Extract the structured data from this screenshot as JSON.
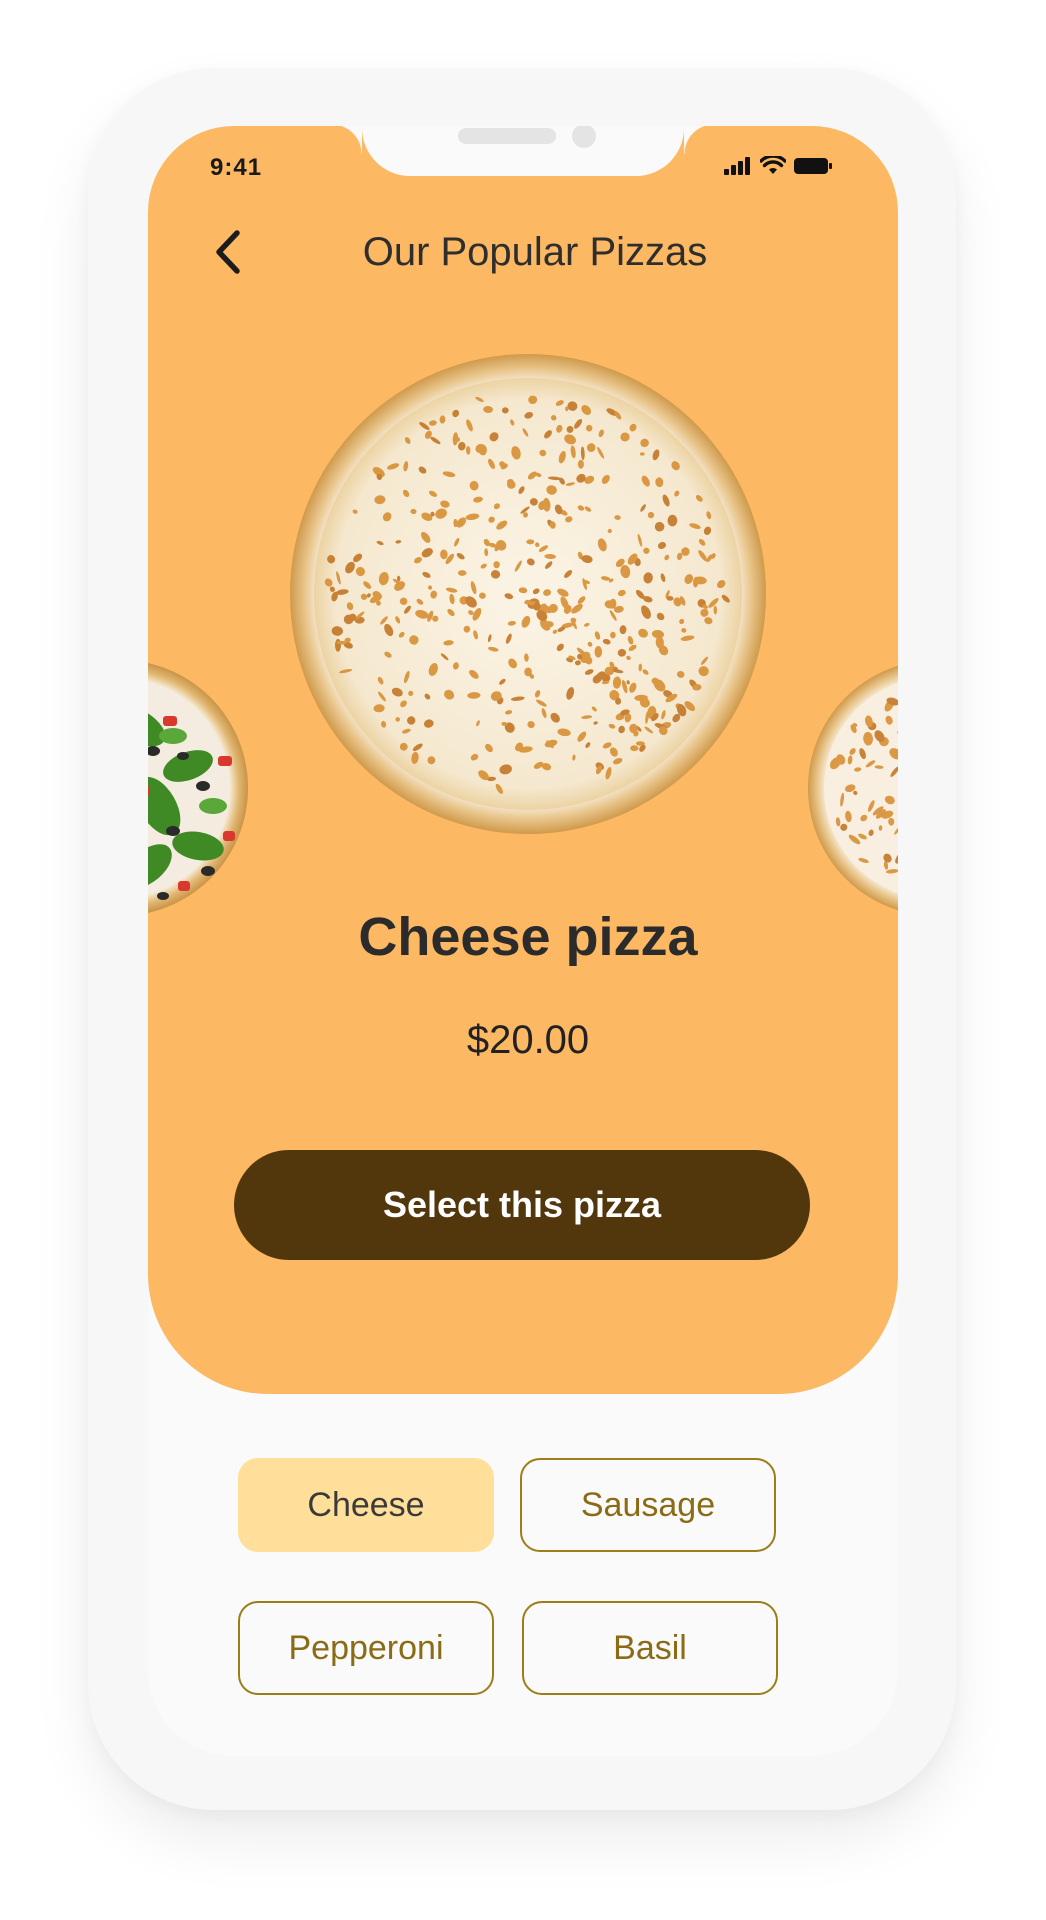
{
  "status_bar": {
    "time": "9:41",
    "icons": [
      "signal-icon",
      "wifi-icon",
      "battery-icon"
    ]
  },
  "header": {
    "back_icon": "chevron-left-icon",
    "title": "Our Popular Pizzas"
  },
  "carousel": {
    "items": [
      {
        "name": "basil-pizza",
        "position": "left"
      },
      {
        "name": "cheese-pizza",
        "position": "center"
      },
      {
        "name": "cheese-pizza",
        "position": "right"
      }
    ]
  },
  "product": {
    "name": "Cheese pizza",
    "price": "$20.00",
    "select_label": "Select this pizza"
  },
  "toppings": [
    {
      "label": "Cheese",
      "selected": true
    },
    {
      "label": "Sausage",
      "selected": false
    },
    {
      "label": "Pepperoni",
      "selected": false
    },
    {
      "label": "Basil",
      "selected": false
    }
  ],
  "colors": {
    "hero_background": "#fcb862",
    "button_background": "#52360c",
    "chip_selected": "#ffdf99",
    "chip_border": "#9b7e18",
    "chip_text": "#8a6c16"
  }
}
